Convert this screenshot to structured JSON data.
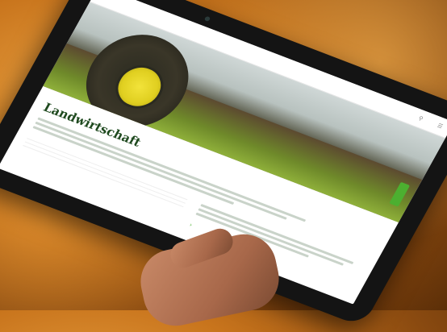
{
  "site": {
    "page_title": "Landwirtschaft"
  },
  "colors": {
    "brand_green": "#4caf30",
    "dark_green": "#1f4a1f",
    "rim_yellow": "#f2e33a"
  },
  "icons": {
    "search": "search-icon",
    "menu": "menu-icon",
    "arrow": "chevron-right-icon"
  }
}
